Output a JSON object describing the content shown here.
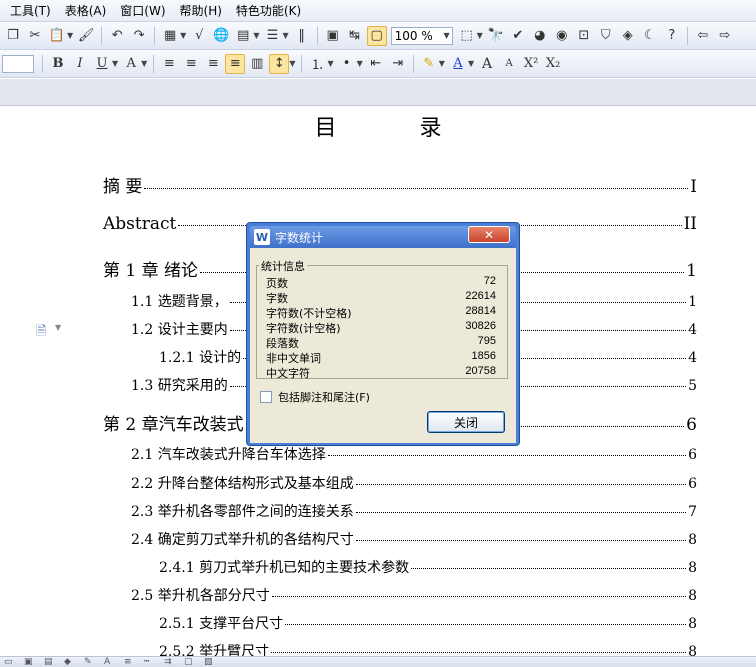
{
  "menu": [
    "工具(T)",
    "表格(A)",
    "窗口(W)",
    "帮助(H)",
    "特色功能(K)"
  ],
  "toolbar": {
    "zoom": "100 %",
    "font_controls": [
      "B",
      "I",
      "U",
      "A"
    ],
    "superscript": "X²",
    "subscript": "X₂",
    "grow_font": "A",
    "shrink_font": "A"
  },
  "document": {
    "toc_title": "目 录",
    "entries": [
      {
        "text": "摘  要",
        "page": "I"
      },
      {
        "text": "Abstract",
        "page": "II"
      },
      {
        "text": "第 1 章  绪论",
        "page": "1"
      },
      {
        "text": "1.1  选题背景，",
        "page": "1"
      },
      {
        "text": "1.2  设计主要内",
        "page": "4"
      },
      {
        "text": "1.2.1 设计的",
        "page": "4"
      },
      {
        "text": "1.3  研究采用的",
        "page": "5"
      },
      {
        "text": "第 2 章汽车改装式",
        "page": "6"
      },
      {
        "text": "2.1 汽车改装式升降台车体选择",
        "page": "6"
      },
      {
        "text": "2.2 升降台整体结构形式及基本组成",
        "page": "6"
      },
      {
        "text": "2.3 举升机各零部件之间的连接关系",
        "page": "7"
      },
      {
        "text": "2.4 确定剪刀式举升机的各结构尺寸",
        "page": "8"
      },
      {
        "text": "2.4.1 剪刀式举升机已知的主要技术参数",
        "page": "8"
      },
      {
        "text": "2.5 举升机各部分尺寸",
        "page": "8"
      },
      {
        "text": "2.5.1 支撑平台尺寸",
        "page": "8"
      },
      {
        "text": "2.5.2 举升臂尺寸",
        "page": "8"
      }
    ]
  },
  "dialog": {
    "title": "字数统计",
    "close_label": "✕",
    "group_label": "统计信息",
    "stats": [
      {
        "label": "页数",
        "value": "72"
      },
      {
        "label": "字数",
        "value": "22614"
      },
      {
        "label": "字符数(不计空格)",
        "value": "28814"
      },
      {
        "label": "字符数(计空格)",
        "value": "30826"
      },
      {
        "label": "段落数",
        "value": "795"
      },
      {
        "label": "非中文单词",
        "value": "1856"
      },
      {
        "label": "中文字符",
        "value": "20758"
      }
    ],
    "checkbox_label": "包括脚注和尾注(F)",
    "checkbox_checked": false,
    "button_label": "关闭"
  }
}
